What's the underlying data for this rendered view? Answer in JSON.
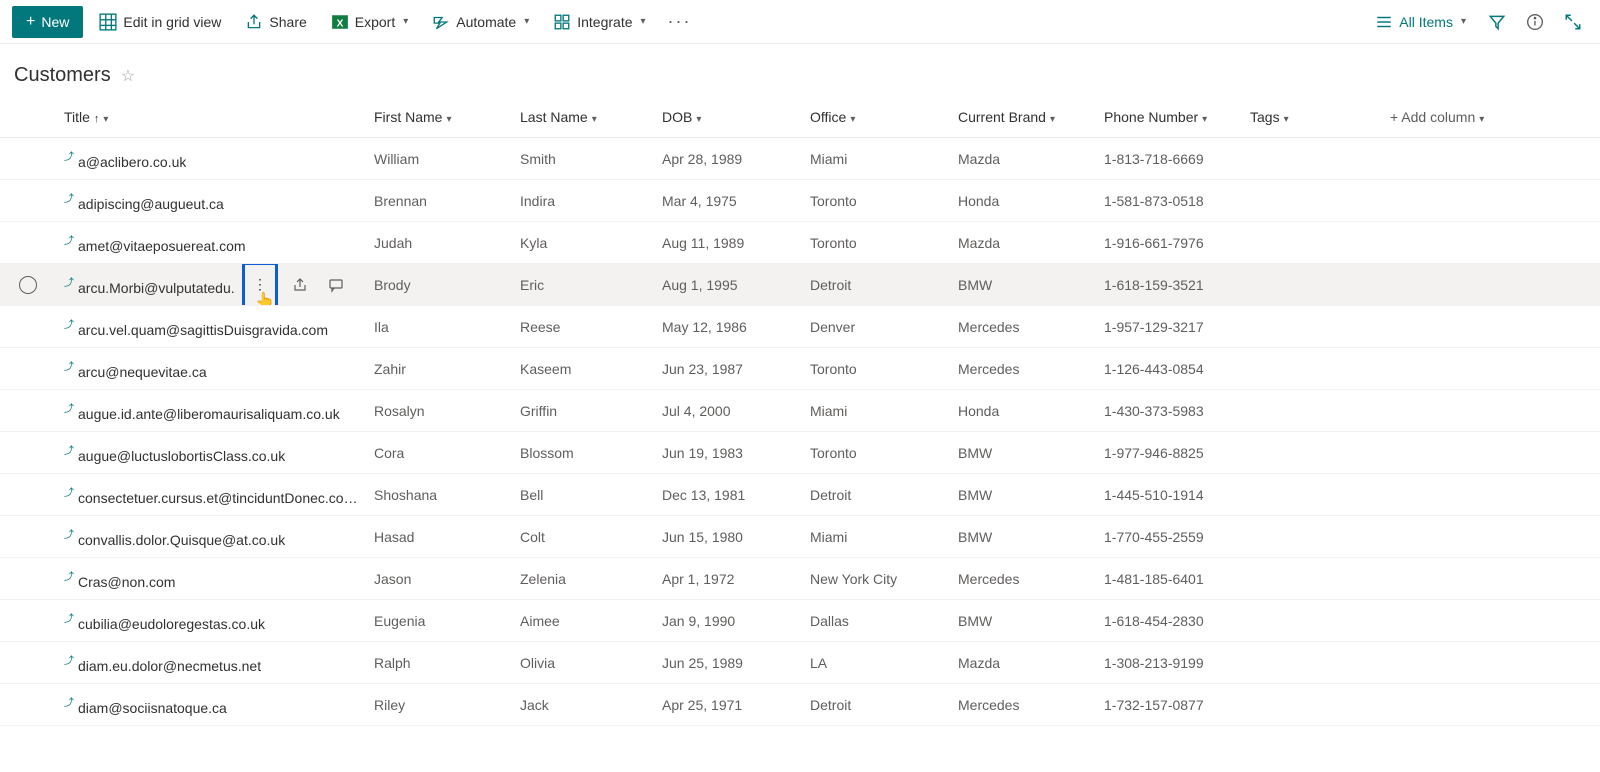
{
  "toolbar": {
    "new_label": "New",
    "edit_grid": "Edit in grid view",
    "share": "Share",
    "export": "Export",
    "automate": "Automate",
    "integrate": "Integrate",
    "view_label": "All Items"
  },
  "page": {
    "title": "Customers"
  },
  "columns": {
    "title": "Title",
    "first": "First Name",
    "last": "Last Name",
    "dob": "DOB",
    "office": "Office",
    "brand": "Current Brand",
    "phone": "Phone Number",
    "tags": "Tags",
    "add": "Add column"
  },
  "rows": [
    {
      "title": "a@aclibero.co.uk",
      "first": "William",
      "last": "Smith",
      "dob": "Apr 28, 1989",
      "office": "Miami",
      "brand": "Mazda",
      "phone": "1-813-718-6669"
    },
    {
      "title": "adipiscing@augueut.ca",
      "first": "Brennan",
      "last": "Indira",
      "dob": "Mar 4, 1975",
      "office": "Toronto",
      "brand": "Honda",
      "phone": "1-581-873-0518"
    },
    {
      "title": "amet@vitaeposuereat.com",
      "first": "Judah",
      "last": "Kyla",
      "dob": "Aug 11, 1989",
      "office": "Toronto",
      "brand": "Mazda",
      "phone": "1-916-661-7976"
    },
    {
      "title": "arcu.Morbi@vulputatedu...",
      "first": "Brody",
      "last": "Eric",
      "dob": "Aug 1, 1995",
      "office": "Detroit",
      "brand": "BMW",
      "phone": "1-618-159-3521",
      "hovered": true
    },
    {
      "title": "arcu.vel.quam@sagittisDuisgravida.com",
      "first": "Ila",
      "last": "Reese",
      "dob": "May 12, 1986",
      "office": "Denver",
      "brand": "Mercedes",
      "phone": "1-957-129-3217"
    },
    {
      "title": "arcu@nequevitae.ca",
      "first": "Zahir",
      "last": "Kaseem",
      "dob": "Jun 23, 1987",
      "office": "Toronto",
      "brand": "Mercedes",
      "phone": "1-126-443-0854"
    },
    {
      "title": "augue.id.ante@liberomaurisaliquam.co.uk",
      "first": "Rosalyn",
      "last": "Griffin",
      "dob": "Jul 4, 2000",
      "office": "Miami",
      "brand": "Honda",
      "phone": "1-430-373-5983"
    },
    {
      "title": "augue@luctuslobortisClass.co.uk",
      "first": "Cora",
      "last": "Blossom",
      "dob": "Jun 19, 1983",
      "office": "Toronto",
      "brand": "BMW",
      "phone": "1-977-946-8825"
    },
    {
      "title": "consectetuer.cursus.et@tinciduntDonec.co.uk",
      "first": "Shoshana",
      "last": "Bell",
      "dob": "Dec 13, 1981",
      "office": "Detroit",
      "brand": "BMW",
      "phone": "1-445-510-1914"
    },
    {
      "title": "convallis.dolor.Quisque@at.co.uk",
      "first": "Hasad",
      "last": "Colt",
      "dob": "Jun 15, 1980",
      "office": "Miami",
      "brand": "BMW",
      "phone": "1-770-455-2559"
    },
    {
      "title": "Cras@non.com",
      "first": "Jason",
      "last": "Zelenia",
      "dob": "Apr 1, 1972",
      "office": "New York City",
      "brand": "Mercedes",
      "phone": "1-481-185-6401"
    },
    {
      "title": "cubilia@eudoloregestas.co.uk",
      "first": "Eugenia",
      "last": "Aimee",
      "dob": "Jan 9, 1990",
      "office": "Dallas",
      "brand": "BMW",
      "phone": "1-618-454-2830"
    },
    {
      "title": "diam.eu.dolor@necmetus.net",
      "first": "Ralph",
      "last": "Olivia",
      "dob": "Jun 25, 1989",
      "office": "LA",
      "brand": "Mazda",
      "phone": "1-308-213-9199"
    },
    {
      "title": "diam@sociisnatoque.ca",
      "first": "Riley",
      "last": "Jack",
      "dob": "Apr 25, 1971",
      "office": "Detroit",
      "brand": "Mercedes",
      "phone": "1-732-157-0877"
    }
  ]
}
